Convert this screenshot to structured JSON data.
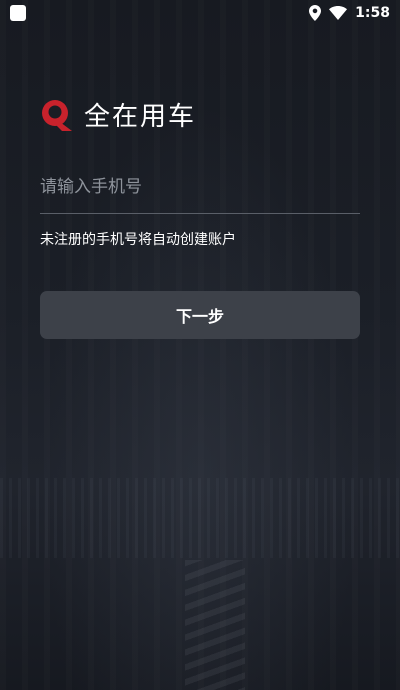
{
  "status_bar": {
    "time": "1:58"
  },
  "logo": {
    "text": "全在用车",
    "brand_color": "#c8222c"
  },
  "phone_input": {
    "placeholder": "请输入手机号",
    "value": ""
  },
  "hint": {
    "text": "未注册的手机号将自动创建账户"
  },
  "next_button": {
    "label": "下一步"
  },
  "colors": {
    "background": "#1a1d24",
    "button": "#3d4149",
    "placeholder": "#8e939b"
  }
}
